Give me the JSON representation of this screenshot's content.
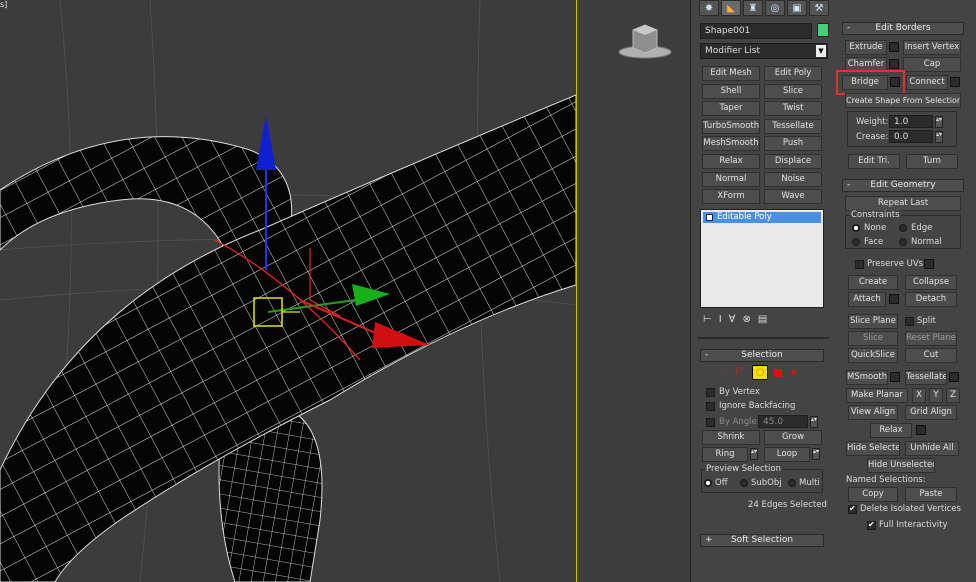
{
  "viewport": {
    "label": "s]"
  },
  "panel": {
    "object_name": "Shape001",
    "object_color": "#3fd07a",
    "modifier_list": "Modifier List",
    "modifier_buttons": [
      [
        "Edit Mesh",
        "Edit Poly"
      ],
      [
        "Shell",
        "Slice"
      ],
      [
        "Taper",
        "Twist"
      ],
      [
        "TurboSmooth",
        "Tessellate"
      ],
      [
        "MeshSmooth",
        "Push"
      ],
      [
        "Relax",
        "Displace"
      ],
      [
        "Normal",
        "Noise"
      ],
      [
        "XForm",
        "Wave"
      ]
    ],
    "stack_item": "Editable Poly",
    "selection": {
      "title": "Selection",
      "by_vertex": "By Vertex",
      "ignore_backfacing": "Ignore Backfacing",
      "by_angle": "By Angle:",
      "angle_value": "45.0",
      "shrink": "Shrink",
      "grow": "Grow",
      "ring": "Ring",
      "loop": "Loop",
      "preview_title": "Preview Selection",
      "off": "Off",
      "subobj": "SubObj",
      "multi": "Multi",
      "status": "24 Edges Selected"
    },
    "soft_selection": "Soft Selection",
    "edit_borders": {
      "title": "Edit Borders",
      "extrude": "Extrude",
      "insert_vertex": "Insert Vertex",
      "chamfer": "Chamfer",
      "cap": "Cap",
      "bridge": "Bridge",
      "connect": "Connect",
      "create_shape": "Create Shape From Selection",
      "weight_label": "Weight:",
      "weight_value": "1.0",
      "crease_label": "Crease:",
      "crease_value": "0.0",
      "edit_tri": "Edit Tri.",
      "turn": "Turn"
    },
    "edit_geometry": {
      "title": "Edit Geometry",
      "repeat_last": "Repeat Last",
      "constraints": "Constraints",
      "none": "None",
      "edge": "Edge",
      "face": "Face",
      "normal": "Normal",
      "preserve_uvs": "Preserve UVs",
      "create": "Create",
      "collapse": "Collapse",
      "attach": "Attach",
      "detach": "Detach",
      "slice_plane": "Slice Plane",
      "split": "Split",
      "slice": "Slice",
      "reset_plane": "Reset Plane",
      "quickslice": "QuickSlice",
      "cut": "Cut",
      "msmooth": "MSmooth",
      "tessellate": "Tessellate",
      "make_planar": "Make Planar",
      "x": "X",
      "y": "Y",
      "z": "Z",
      "view_align": "View Align",
      "grid_align": "Grid Align",
      "relax": "Relax",
      "hide_selected": "Hide Selected",
      "unhide_all": "Unhide All",
      "hide_unselected": "Hide Unselected",
      "named_selections": "Named Selections:",
      "copy": "Copy",
      "paste": "Paste",
      "delete_isolated": "Delete Isolated Vertices",
      "full_interactivity": "Full Interactivity"
    }
  }
}
